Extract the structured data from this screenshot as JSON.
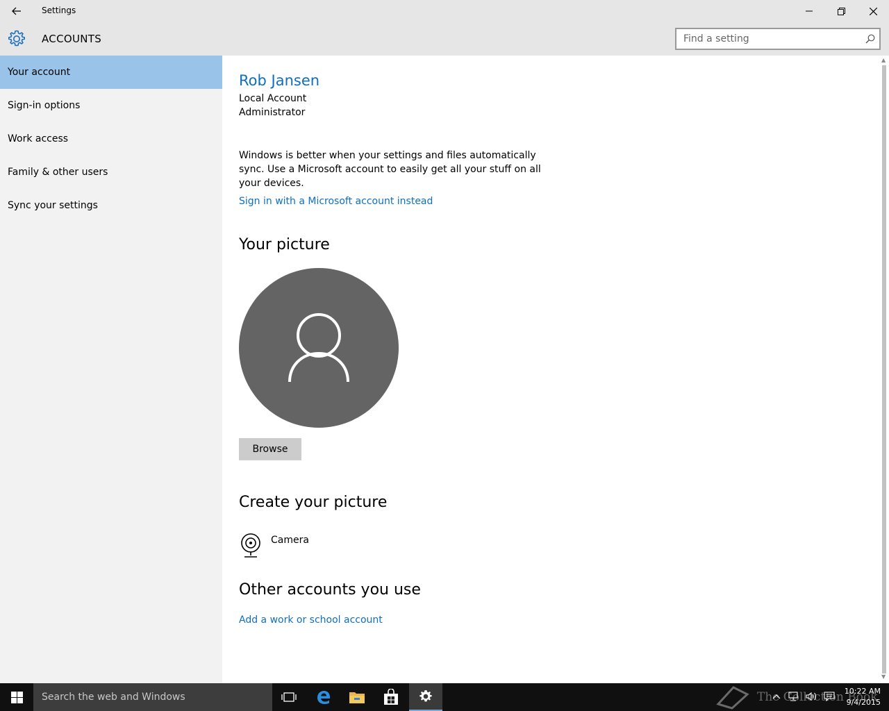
{
  "window": {
    "title": "Settings"
  },
  "header": {
    "section": "ACCOUNTS",
    "search_placeholder": "Find a setting"
  },
  "sidebar": {
    "items": [
      {
        "label": "Your account",
        "active": true
      },
      {
        "label": "Sign-in options",
        "active": false
      },
      {
        "label": "Work access",
        "active": false
      },
      {
        "label": "Family & other users",
        "active": false
      },
      {
        "label": "Sync your settings",
        "active": false
      }
    ]
  },
  "account": {
    "name": "Rob Jansen",
    "type": "Local Account",
    "role": "Administrator",
    "sync_message": "Windows is better when your settings and files automatically sync. Use a Microsoft account to easily get all your stuff on all your devices.",
    "ms_link": "Sign in with a Microsoft account instead"
  },
  "picture": {
    "heading": "Your picture",
    "browse_label": "Browse"
  },
  "create": {
    "heading": "Create your picture",
    "camera_label": "Camera"
  },
  "other_accounts": {
    "heading": "Other accounts you use",
    "add_link": "Add a work or school account"
  },
  "taskbar": {
    "search_placeholder": "Search the web and Windows",
    "watermark": "The Collection Book",
    "time": "10:22 AM",
    "date": "9/4/2015"
  },
  "colors": {
    "accent": "#0f6fbf",
    "nav_active": "#99c3e8",
    "chrome": "#e6e6e6",
    "sidebar": "#f2f2f2",
    "avatar": "#646464"
  }
}
